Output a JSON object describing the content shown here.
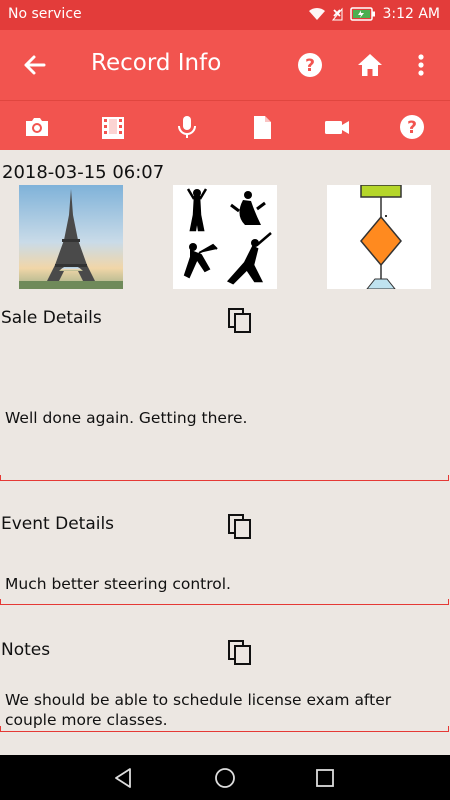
{
  "status": {
    "carrier": "No service",
    "time": "3:12 AM"
  },
  "appbar": {
    "title": "Record Info",
    "icons": [
      "back-arrow-icon",
      "help-icon",
      "home-icon",
      "more-vert-icon"
    ]
  },
  "toolbar": {
    "icons": [
      "camera-icon",
      "film-icon",
      "microphone-icon",
      "document-icon",
      "video-icon",
      "help-icon"
    ]
  },
  "record": {
    "date": "2018-03-15 06:07"
  },
  "sections": {
    "sale": {
      "title": "Sale Details",
      "text": "Well done again. Getting there."
    },
    "event": {
      "title": "Event Details",
      "text": "Much better steering control."
    },
    "notes": {
      "title": "Notes",
      "text": "We should be able to schedule license exam after couple more classes."
    }
  },
  "colors": {
    "status_bar": "#e33c3a",
    "app_bar": "#f2544f",
    "background": "#ece7e2",
    "accent_line": "#e53935"
  }
}
